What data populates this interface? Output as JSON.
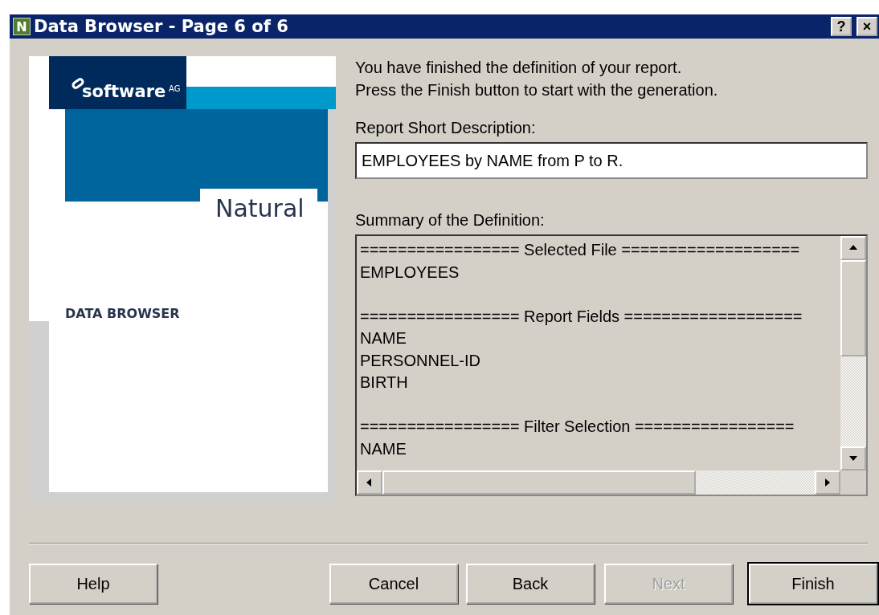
{
  "window": {
    "icon_letter": "N",
    "title": "Data Browser - Page 6 of 6",
    "title_buttons": [
      "?",
      "×"
    ]
  },
  "banner": {
    "brand": "software",
    "brand_suffix": "AG",
    "product": "Natural",
    "caption": "DATA BROWSER"
  },
  "intro": [
    "You have finished the definition of your report.",
    "Press the Finish button to start with the generation."
  ],
  "description": {
    "label": "Report Short Description:",
    "value": "EMPLOYEES by NAME from P to R."
  },
  "summary": {
    "label": "Summary of the Definition:",
    "sections": [
      {
        "heading": "================= Selected File ===================",
        "items": [
          "EMPLOYEES"
        ]
      },
      {
        "heading": "================= Report Fields ===================",
        "items": [
          "NAME",
          "PERSONNEL-ID",
          "BIRTH"
        ]
      },
      {
        "heading": "================= Filter Selection =================",
        "items": [
          "NAME"
        ]
      }
    ]
  },
  "buttons": [
    {
      "label": "Help",
      "disabled": false,
      "default": false
    },
    {
      "label": "Cancel",
      "disabled": false,
      "default": false
    },
    {
      "label": "Back",
      "disabled": false,
      "default": false
    },
    {
      "label": "Next",
      "disabled": true,
      "default": false
    },
    {
      "label": "Finish",
      "disabled": false,
      "default": true
    }
  ]
}
